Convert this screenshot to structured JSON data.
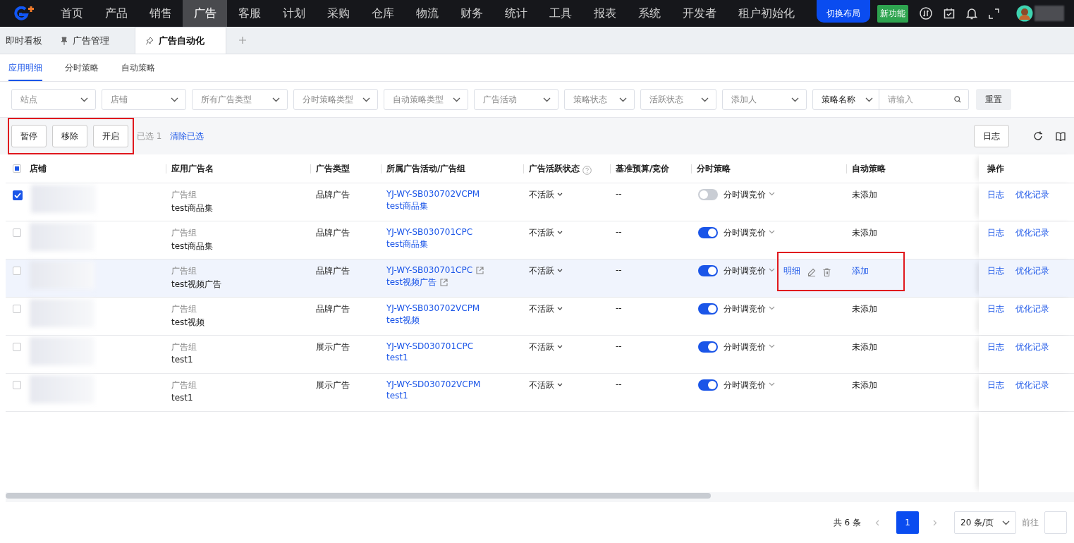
{
  "nav": {
    "items": [
      {
        "label": "首页",
        "selected": false
      },
      {
        "label": "产品",
        "selected": false
      },
      {
        "label": "销售",
        "selected": false
      },
      {
        "label": "广告",
        "selected": true
      },
      {
        "label": "客服",
        "selected": false
      },
      {
        "label": "计划",
        "selected": false
      },
      {
        "label": "采购",
        "selected": false
      },
      {
        "label": "仓库",
        "selected": false
      },
      {
        "label": "物流",
        "selected": false
      },
      {
        "label": "财务",
        "selected": false
      },
      {
        "label": "统计",
        "selected": false
      },
      {
        "label": "工具",
        "selected": false
      },
      {
        "label": "报表",
        "selected": false
      },
      {
        "label": "系统",
        "selected": false
      },
      {
        "label": "开发者",
        "selected": false
      },
      {
        "label": "租户初始化",
        "selected": false
      }
    ],
    "switch_layout": "切换布局",
    "new_feature": "新功能"
  },
  "page_tabs": [
    {
      "label": "即时看板",
      "kind": "plain",
      "selected": false
    },
    {
      "label": "广告管理",
      "kind": "pinned",
      "selected": false
    },
    {
      "label": "广告自动化",
      "kind": "unpinned",
      "selected": true
    }
  ],
  "sub_tabs": [
    {
      "label": "应用明细",
      "selected": true
    },
    {
      "label": "分时策略",
      "selected": false
    },
    {
      "label": "自动策略",
      "selected": false
    }
  ],
  "filters": [
    {
      "placeholder": "站点"
    },
    {
      "placeholder": "店铺"
    },
    {
      "placeholder": "所有广告类型"
    },
    {
      "placeholder": "分时策略类型"
    },
    {
      "placeholder": "自动策略类型"
    },
    {
      "placeholder": "广告活动"
    },
    {
      "placeholder": "策略状态"
    },
    {
      "placeholder": "活跃状态"
    },
    {
      "placeholder": "添加人"
    }
  ],
  "search": {
    "field": "策略名称",
    "placeholder": "请输入"
  },
  "reset_button": "重置",
  "toolbar": {
    "buttons": [
      "暂停",
      "移除",
      "开启"
    ],
    "selected_count": "已选 1",
    "clear_link": "清除已选",
    "log_button": "日志"
  },
  "table": {
    "select_all_partial": true,
    "columns": [
      {
        "label": "店铺",
        "help": false
      },
      {
        "label": "应用广告名",
        "help": false
      },
      {
        "label": "广告类型",
        "help": false
      },
      {
        "label": "所属广告活动/广告组",
        "help": false
      },
      {
        "label": "广告活跃状态",
        "help": true
      },
      {
        "label": "基准预算/竞价",
        "help": false
      },
      {
        "label": "分时策略",
        "help": false
      },
      {
        "label": "自动策略",
        "help": false
      },
      {
        "label": "操作",
        "help": false
      }
    ],
    "rows": [
      {
        "checked": true,
        "hovered": false,
        "ad_level": "广告组",
        "ad_name": "test商品集",
        "ad_type": "品牌广告",
        "campaign": "YJ-WY-SB030702VCPM",
        "group": "test商品集",
        "links": false,
        "status": "不活跃",
        "budget": "--",
        "timed_on": false,
        "timed": "分时调竞价",
        "detail": "",
        "auto": "未添加",
        "auto_link": false,
        "ops": [
          "日志",
          "优化记录"
        ]
      },
      {
        "checked": false,
        "hovered": false,
        "ad_level": "广告组",
        "ad_name": "test商品集",
        "ad_type": "品牌广告",
        "campaign": "YJ-WY-SB030701CPC",
        "group": "test商品集",
        "links": false,
        "status": "不活跃",
        "budget": "--",
        "timed_on": true,
        "timed": "分时调竞价",
        "detail": "",
        "auto": "未添加",
        "auto_link": false,
        "ops": [
          "日志",
          "优化记录"
        ]
      },
      {
        "checked": false,
        "hovered": true,
        "ad_level": "广告组",
        "ad_name": "test视频广告",
        "ad_type": "品牌广告",
        "campaign": "YJ-WY-SB030701CPC",
        "group": "test视频广告",
        "links": true,
        "status": "不活跃",
        "budget": "--",
        "timed_on": true,
        "timed": "分时调竞价",
        "detail": "明细",
        "auto": "添加",
        "auto_link": true,
        "ops": [
          "日志",
          "优化记录"
        ]
      },
      {
        "checked": false,
        "hovered": false,
        "ad_level": "广告组",
        "ad_name": "test视频",
        "ad_type": "品牌广告",
        "campaign": "YJ-WY-SB030702VCPM",
        "group": "test视频",
        "links": false,
        "status": "不活跃",
        "budget": "--",
        "timed_on": true,
        "timed": "分时调竞价",
        "detail": "",
        "auto": "未添加",
        "auto_link": false,
        "ops": [
          "日志",
          "优化记录"
        ]
      },
      {
        "checked": false,
        "hovered": false,
        "ad_level": "广告组",
        "ad_name": "test1",
        "ad_type": "展示广告",
        "campaign": "YJ-WY-SD030701CPC",
        "group": "test1",
        "links": false,
        "status": "不活跃",
        "budget": "--",
        "timed_on": true,
        "timed": "分时调竞价",
        "detail": "",
        "auto": "未添加",
        "auto_link": false,
        "ops": [
          "日志",
          "优化记录"
        ]
      },
      {
        "checked": false,
        "hovered": false,
        "ad_level": "广告组",
        "ad_name": "test1",
        "ad_type": "展示广告",
        "campaign": "YJ-WY-SD030702VCPM",
        "group": "test1",
        "links": false,
        "status": "不活跃",
        "budget": "--",
        "timed_on": true,
        "timed": "分时调竞价",
        "detail": "",
        "auto": "未添加",
        "auto_link": false,
        "ops": [
          "日志",
          "优化记录"
        ]
      }
    ]
  },
  "pagination": {
    "total": "共 6 条",
    "pages": [
      {
        "label": "1",
        "selected": true
      }
    ],
    "page_size": "20 条/页",
    "goto": "前往"
  }
}
